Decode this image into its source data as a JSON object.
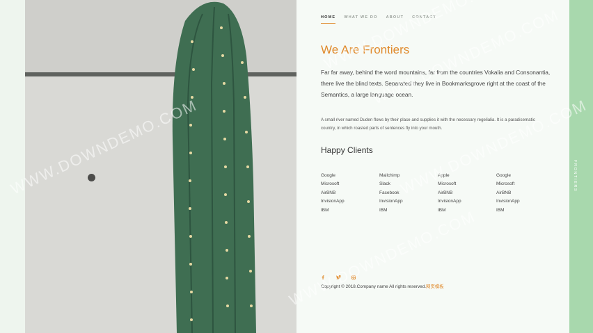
{
  "nav": {
    "items": [
      {
        "label": "Home",
        "active": true
      },
      {
        "label": "What we do",
        "active": false
      },
      {
        "label": "About",
        "active": false
      },
      {
        "label": "Contact",
        "active": false
      }
    ]
  },
  "main": {
    "title": "We Are Frontiers",
    "lead": "Far far away, behind the word mountains, far from the countries Vokalia and Consonantia, there live the blind texts. Separated they live in Bookmarksgrove right at the coast of the Semantics, a large language ocean.",
    "small": "A small river named Duden flows by their place and supplies it with the necessary regelialia. It is a paradisematic country, in which roasted parts of sentences fly into your mouth."
  },
  "clients": {
    "title": "Happy Clients",
    "columns": [
      [
        "Google",
        "Microsoft",
        "AirBNB",
        "InvisionApp",
        "IBM"
      ],
      [
        "Mailchimp",
        "Slack",
        "Facebook",
        "InvisionApp",
        "IBM"
      ],
      [
        "Apple",
        "Microsoft",
        "AirBNB",
        "InvisionApp",
        "IBM"
      ],
      [
        "Google",
        "Microsoft",
        "AirBNB",
        "InvisionApp",
        "IBM"
      ]
    ]
  },
  "social": {
    "icons": [
      "facebook-icon",
      "twitter-icon",
      "instagram-icon"
    ]
  },
  "footer": {
    "copyright": "Copyright © 2018.Company name All rights reserved.",
    "link_text": "网页模板"
  },
  "sidebar": {
    "brand": "FRONTIERS"
  },
  "watermark": {
    "text": "WWW.DOWNDEMO.COM"
  },
  "colors": {
    "accent": "#e08a2c",
    "sidebar": "#a8d8ad",
    "cactus": "#3f6e52"
  }
}
